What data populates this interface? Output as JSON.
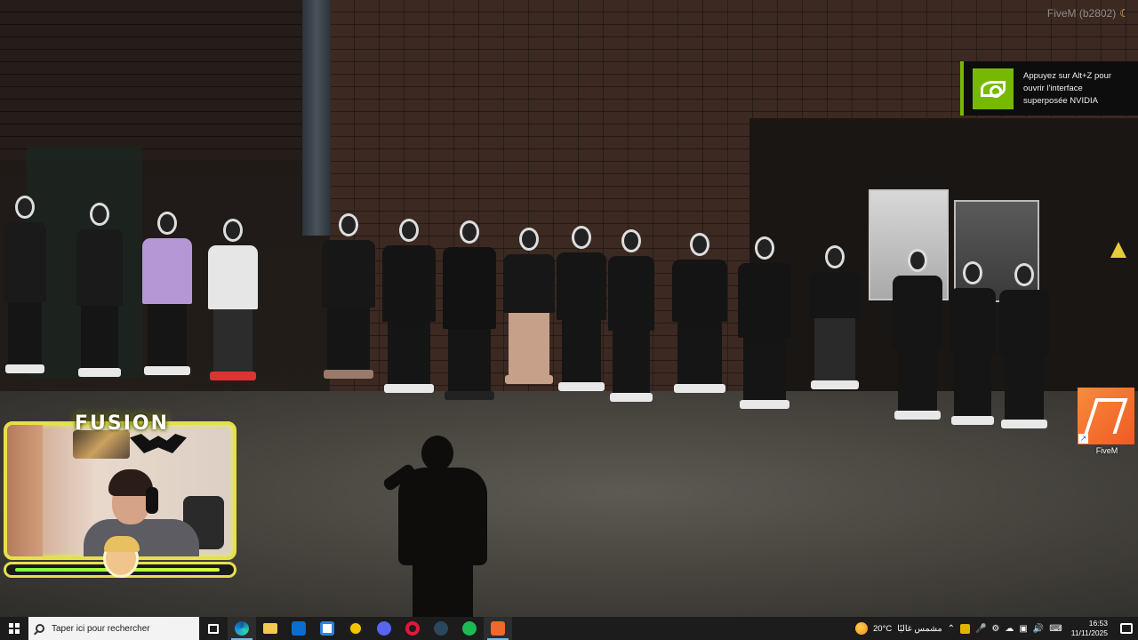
{
  "game": {
    "build_label": "FiveM (b2802)",
    "build_icon": "moon-icon"
  },
  "nvidia_toast": {
    "icon": "nvidia-logo-icon",
    "line1": "Appuyez sur Alt+Z pour",
    "line2": "ouvrir l'interface",
    "line3": "superposée NVIDIA",
    "accent": "#76b900"
  },
  "desktop": {
    "shortcut_label": "FiveM",
    "shortcut_icon": "fivem-icon"
  },
  "overlay": {
    "title": "FUSION",
    "frame_color": "#e6e04a",
    "bar_color": "#7cff3a"
  },
  "taskbar": {
    "search_placeholder": "Taper ici pour rechercher",
    "apps": [
      "task-view-icon",
      "edge-icon",
      "file-explorer-icon",
      "outlook-icon",
      "microsoft-store-icon",
      "norton-icon",
      "discord-icon",
      "opera-gx-icon",
      "steam-icon",
      "spotify-icon",
      "fivem-icon"
    ],
    "weather": {
      "temp": "20°C",
      "condition": "مشمس غالبًا"
    },
    "time": "16:53",
    "date": "11/11/2025"
  }
}
